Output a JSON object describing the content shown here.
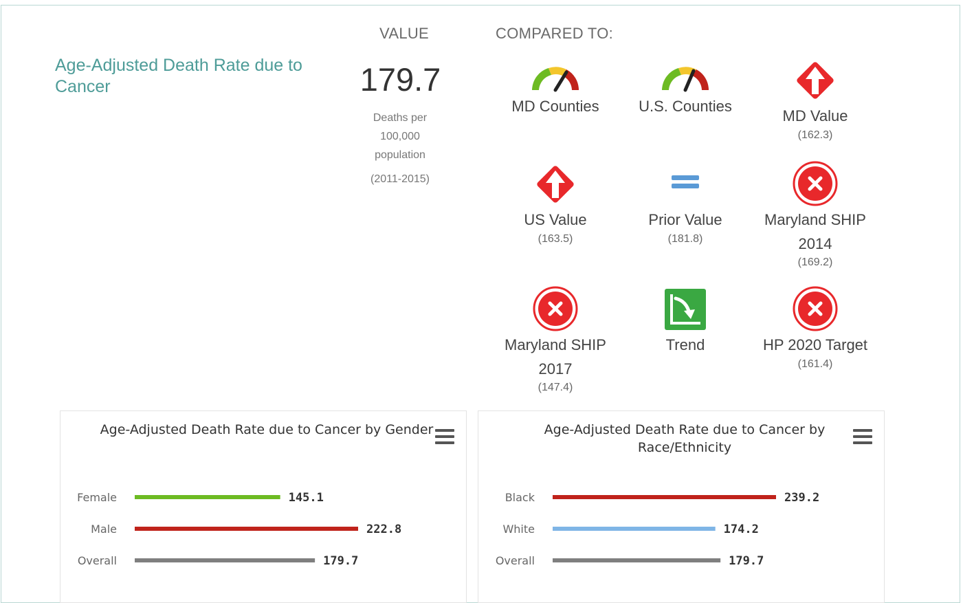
{
  "indicator": {
    "title": "Age-Adjusted Death Rate due to Cancer",
    "value_header": "VALUE",
    "compared_header": "COMPARED TO:",
    "value": "179.7",
    "units": [
      "Deaths per",
      "100,000",
      "population"
    ],
    "period": "(2011-2015)"
  },
  "comparisons": [
    {
      "label": "MD Counties",
      "value": "",
      "icon": "gauge-icon"
    },
    {
      "label": "U.S. Counties",
      "value": "",
      "icon": "gauge-icon"
    },
    {
      "label": "MD Value",
      "value": "(162.3)",
      "icon": "red-diamond-up-arrow-icon"
    },
    {
      "label": "US Value",
      "value": "(163.5)",
      "icon": "red-diamond-up-arrow-icon"
    },
    {
      "label": "Prior Value",
      "value": "(181.8)",
      "icon": "equals-icon"
    },
    {
      "label": "Maryland SHIP 2014",
      "value": "(169.2)",
      "icon": "red-x-circle-icon"
    },
    {
      "label": "Maryland SHIP 2017",
      "value": "(147.4)",
      "icon": "red-x-circle-icon"
    },
    {
      "label": "Trend",
      "value": "",
      "icon": "green-trend-down-icon"
    },
    {
      "label": "HP 2020 Target",
      "value": "(161.4)",
      "icon": "red-x-circle-icon"
    }
  ],
  "colors": {
    "title_teal": "#4e9c98",
    "green": "#6dbb23",
    "red": "#c0231b",
    "gray": "#7f7f7f",
    "blue": "#7fb5e6",
    "alert_red": "#e8282b",
    "equals_blue": "#5a9ad6"
  },
  "chart_data": [
    {
      "type": "bar",
      "title": "Age-Adjusted Death Rate due to Cancer by Gender",
      "categories": [
        "Female",
        "Male",
        "Overall"
      ],
      "values": [
        145.1,
        222.8,
        179.7
      ],
      "labels": [
        "145.1",
        "222.8",
        "179.7"
      ],
      "colors": [
        "#6dbb23",
        "#c0231b",
        "#7f7f7f"
      ],
      "xlim": [
        0,
        222.8
      ],
      "grid": false
    },
    {
      "type": "bar",
      "title": "Age-Adjusted Death Rate due to Cancer by Race/Ethnicity",
      "categories": [
        "Black",
        "White",
        "Overall"
      ],
      "values": [
        239.2,
        174.2,
        179.7
      ],
      "labels": [
        "239.2",
        "174.2",
        "179.7"
      ],
      "colors": [
        "#c0231b",
        "#7fb5e6",
        "#7f7f7f"
      ],
      "xlim": [
        0,
        239.2
      ],
      "grid": false
    }
  ]
}
